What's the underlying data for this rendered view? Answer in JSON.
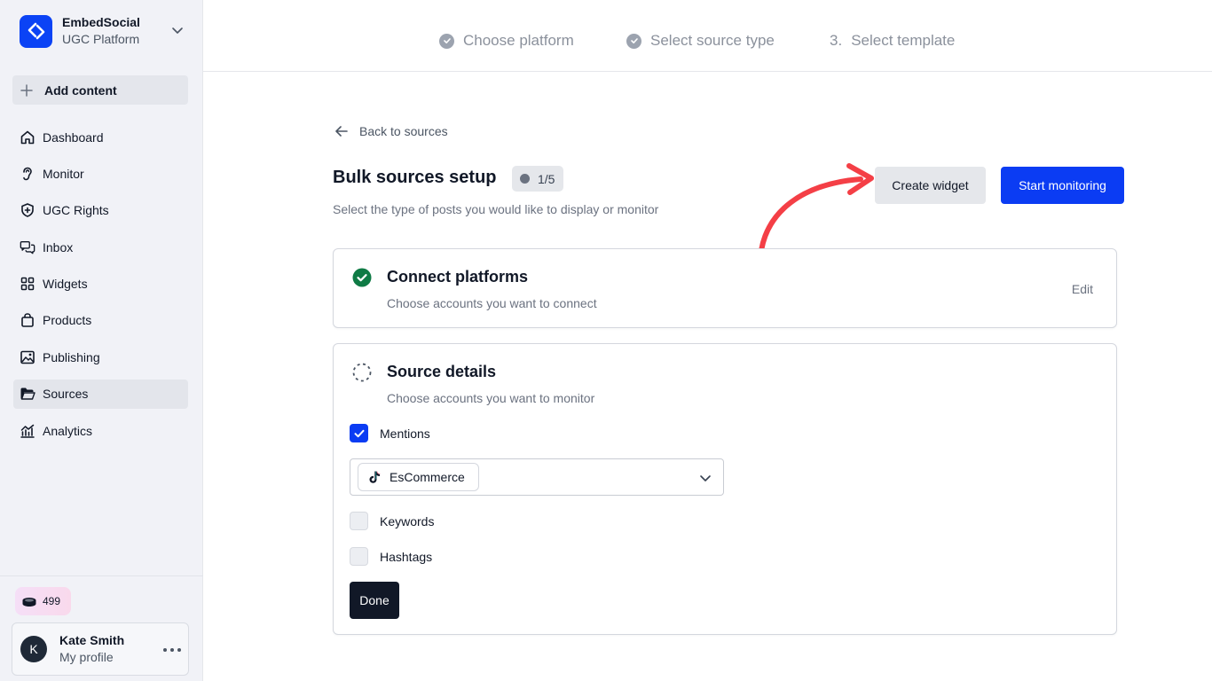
{
  "brand": {
    "name": "EmbedSocial",
    "subtitle": "UGC Platform"
  },
  "sidebar": {
    "add_content": "Add content",
    "items": [
      {
        "label": "Dashboard",
        "icon": "home-icon"
      },
      {
        "label": "Monitor",
        "icon": "ear-icon"
      },
      {
        "label": "UGC Rights",
        "icon": "shield-icon"
      },
      {
        "label": "Inbox",
        "icon": "chat-icon"
      },
      {
        "label": "Widgets",
        "icon": "grid-icon"
      },
      {
        "label": "Products",
        "icon": "bag-icon"
      },
      {
        "label": "Publishing",
        "icon": "image-icon"
      },
      {
        "label": "Sources",
        "icon": "folder-icon",
        "active": true
      },
      {
        "label": "Analytics",
        "icon": "chart-icon"
      }
    ],
    "credits": "499",
    "profile": {
      "initial": "K",
      "name": "Kate Smith",
      "subtitle": "My profile"
    }
  },
  "stepper": {
    "steps": [
      {
        "label": "Choose platform",
        "state": "done"
      },
      {
        "label": "Select source type",
        "state": "done"
      },
      {
        "number": "3.",
        "label": "Select template",
        "state": "pending"
      }
    ]
  },
  "main": {
    "back_label": "Back to sources",
    "title": "Bulk sources setup",
    "step_badge": "1/5",
    "subtitle": "Select the type of posts you would like to display or monitor",
    "create_widget": "Create widget",
    "start_monitoring": "Start monitoring",
    "connect": {
      "title": "Connect platforms",
      "subtitle": "Choose accounts you want to connect",
      "edit": "Edit"
    },
    "source_details": {
      "title": "Source details",
      "subtitle": "Choose accounts you want to monitor",
      "mentions": {
        "label": "Mentions",
        "checked": true
      },
      "account": "EsCommerce",
      "keywords": {
        "label": "Keywords",
        "checked": false
      },
      "hashtags": {
        "label": "Hashtags",
        "checked": false
      },
      "done": "Done"
    }
  },
  "colors": {
    "primary": "#0b3cf3",
    "success": "#0f7b45",
    "annotation": "#f43f46"
  }
}
